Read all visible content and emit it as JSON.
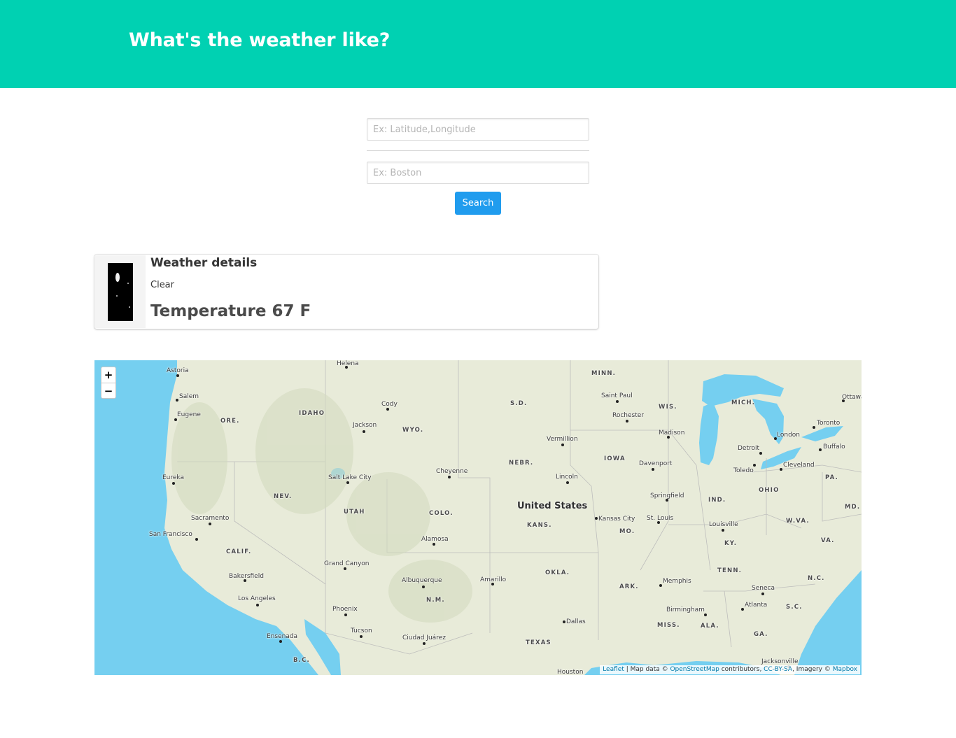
{
  "header": {
    "title": "What's the weather like?"
  },
  "search": {
    "coords_placeholder": "Ex: Latitude,Longitude",
    "city_placeholder": "Ex: Boston",
    "button_label": "Search"
  },
  "weather_card": {
    "icon": "night-clear-icon",
    "title": "Weather details",
    "description": "Clear",
    "temperature": "Temperature 67 F"
  },
  "map": {
    "zoom_in_label": "+",
    "zoom_out_label": "−",
    "country_label": "United States",
    "state_labels": [
      "MINN.",
      "S.D.",
      "IDAHO",
      "ORE.",
      "WYO.",
      "WIS.",
      "MICH.",
      "NEBR.",
      "IOWA",
      "NEV.",
      "UTAH",
      "COLO.",
      "KANS.",
      "MO.",
      "IND.",
      "OHIO",
      "PA.",
      "CALIF.",
      "KY.",
      "W.VA.",
      "VA.",
      "MD.",
      "TENN.",
      "N.C.",
      "OKLA.",
      "ARK.",
      "N.M.",
      "S.C.",
      "MISS.",
      "ALA.",
      "GA.",
      "TEXAS",
      "B.C."
    ],
    "cities": [
      "Astoria",
      "Helena",
      "Saint Paul",
      "Salem",
      "Cody",
      "Rochester",
      "Eugene",
      "Jackson",
      "Madison",
      "Vermillion",
      "Detroit",
      "London",
      "Toronto",
      "Buffalo",
      "Ottawa",
      "Cheyenne",
      "Davenport",
      "Toledo",
      "Cleveland",
      "Salt Lake City",
      "Lincoln",
      "Eureka",
      "Springfield",
      "Sacramento",
      "Kansas City",
      "St. Louis",
      "Louisville",
      "San Francisco",
      "Alamosa",
      "Grand Canyon",
      "Bakersfield",
      "Amarillo",
      "Albuquerque",
      "Memphis",
      "Seneca",
      "Los Angeles",
      "Phoenix",
      "Birmingham",
      "Atlanta",
      "Dallas",
      "Tucson",
      "Ensenada",
      "Ciudad Juárez",
      "Jacksonville",
      "Houston"
    ],
    "attribution": {
      "leaflet": "Leaflet",
      "map_data": " | Map data © ",
      "osm": "OpenStreetMap",
      "contributors": " contributors, ",
      "license": "CC-BY-SA",
      "imagery": ", Imagery © ",
      "mapbox": "Mapbox"
    },
    "colors": {
      "water": "#75cff0",
      "land": "#e8ebd9"
    }
  },
  "colors": {
    "hero": "#00d1b2",
    "button": "#209cee"
  }
}
